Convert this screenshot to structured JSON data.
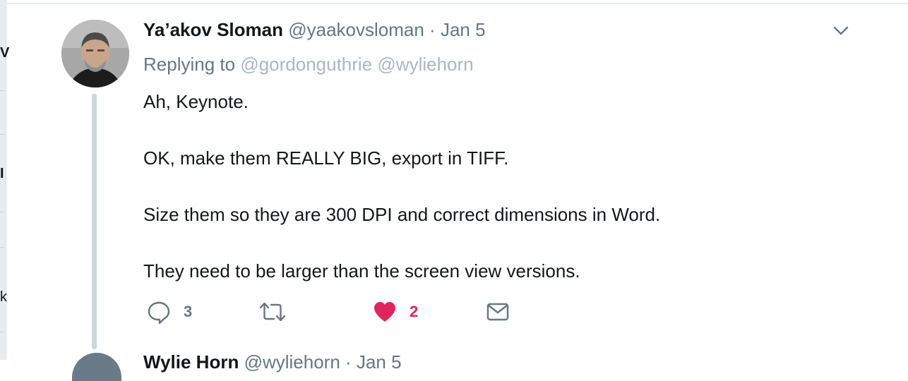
{
  "tweet": {
    "author_name": "Ya’akov Sloman",
    "author_handle": "@yaakovsloman",
    "separator": "·",
    "date": "Jan 5",
    "replying_label": "Replying to",
    "reply_mentions": [
      "@gordonguthrie",
      "@wyliehorn"
    ],
    "paragraphs": [
      "Ah, Keynote.",
      "OK, make them REALLY BIG, export in TIFF.",
      "Size them so they are 300 DPI and correct dimensions in Word.",
      "They need to be larger than the screen view versions."
    ],
    "reply_count": "3",
    "like_count": "2",
    "like_color": "#e0245e",
    "icons": {
      "menu": "chevron-down-icon",
      "reply": "speech-bubble-icon",
      "retweet": "retweet-icon",
      "like": "heart-icon",
      "dm": "envelope-icon"
    }
  },
  "next_tweet": {
    "author_name": "Wylie Horn",
    "author_handle": "@wyliehorn",
    "separator": "·",
    "date": "Jan 5"
  }
}
